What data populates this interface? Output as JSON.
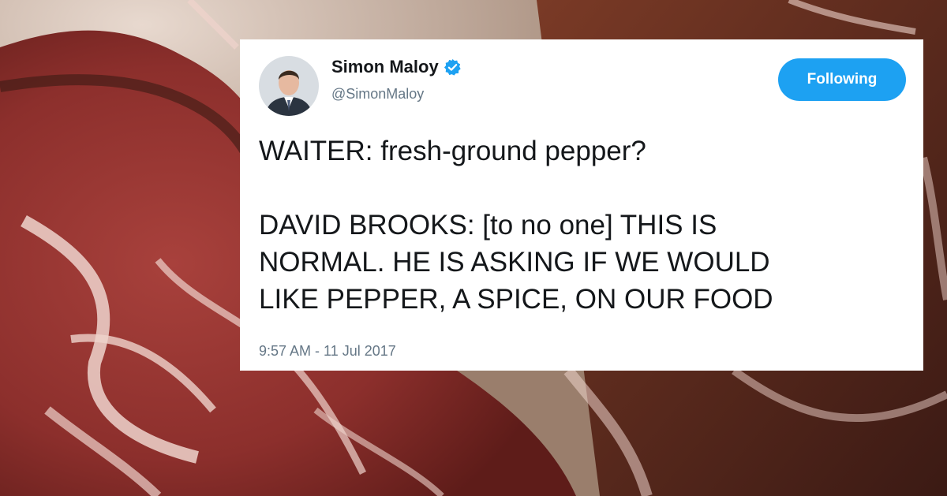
{
  "background": {
    "description_icon": "cured-ham-photo",
    "colors": {
      "meat": "#8c2f2c",
      "fat": "#efd3cc",
      "shadow": "#3b1a14",
      "bg": "#b8a08f"
    }
  },
  "tweet": {
    "author": {
      "display_name": "Simon Maloy",
      "handle": "@SimonMaloy",
      "verified_icon": "verified-badge-icon",
      "avatar_icon": "profile-avatar"
    },
    "follow_button_label": "Following",
    "text_lines": {
      "line1": "WAITER: fresh-ground pepper?",
      "line2": "DAVID BROOKS: [to no one] THIS IS",
      "line3": "NORMAL. HE IS ASKING IF WE WOULD",
      "line4": "LIKE PEPPER, A SPICE, ON OUR FOOD"
    },
    "timestamp": "9:57 AM - 11 Jul 2017",
    "accent_color": "#1da1f2"
  }
}
